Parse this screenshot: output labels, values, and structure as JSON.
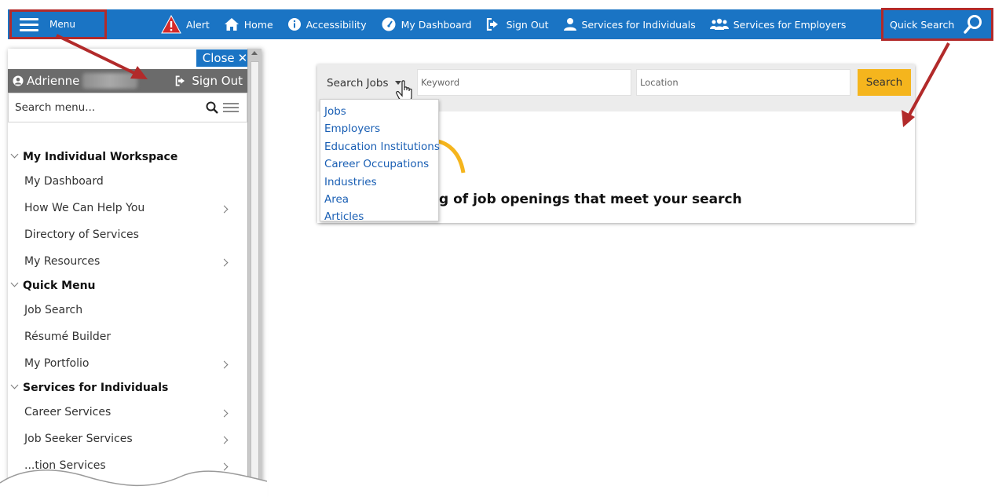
{
  "topbar": {
    "menu_label": "Menu",
    "nav": [
      {
        "label": "Alert",
        "icon": "alert-icon"
      },
      {
        "label": "Home",
        "icon": "home-icon"
      },
      {
        "label": "Accessibility",
        "icon": "info-icon"
      },
      {
        "label": "My Dashboard",
        "icon": "dashboard-icon"
      },
      {
        "label": "Sign Out",
        "icon": "sign-out-icon"
      },
      {
        "label": "Services for Individuals",
        "icon": "user-icon"
      },
      {
        "label": "Services for Employers",
        "icon": "users-icon"
      }
    ],
    "quick_search_label": "Quick Search"
  },
  "side_menu": {
    "close_label": "Close",
    "user_name": "Adrienne",
    "sign_out_label": "Sign Out",
    "search_placeholder": "Search menu...",
    "sections": [
      {
        "title": "My Individual Workspace",
        "items": [
          {
            "label": "My Dashboard",
            "has_submenu": false
          },
          {
            "label": "How We Can Help You",
            "has_submenu": true
          },
          {
            "label": "Directory of Services",
            "has_submenu": false
          },
          {
            "label": "My Resources",
            "has_submenu": true
          }
        ]
      },
      {
        "title": "Quick Menu",
        "items": [
          {
            "label": "Job Search",
            "has_submenu": false
          },
          {
            "label": "Résumé Builder",
            "has_submenu": false
          },
          {
            "label": "My Portfolio",
            "has_submenu": true
          }
        ]
      },
      {
        "title": "Services for Individuals",
        "items": [
          {
            "label": "Career Services",
            "has_submenu": true
          },
          {
            "label": "Job Seeker Services",
            "has_submenu": true
          },
          {
            "label": "...tion Services",
            "has_submenu": true
          }
        ]
      }
    ]
  },
  "job_search": {
    "type_label": "Search Jobs",
    "keyword_placeholder": "Keyword",
    "location_placeholder": "Location",
    "search_button": "Search",
    "dropdown_options": [
      "Jobs",
      "Employers",
      "Education Institutions",
      "Career Occupations",
      "Industries",
      "Area",
      "Articles"
    ],
    "headline": "g of job openings that meet your search"
  },
  "colors": {
    "nav_blue": "#1a74c4",
    "annotation_red": "#b22a2a",
    "search_yellow": "#f5b51d",
    "link_blue": "#1a5fb4"
  }
}
